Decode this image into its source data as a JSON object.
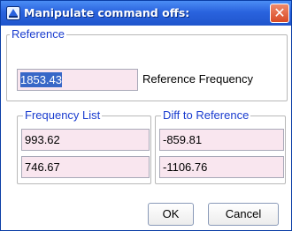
{
  "window": {
    "title": "Manipulate command offs:",
    "close_glyph": "✕",
    "colors": {
      "titlebar": "#2a63de",
      "accent_text": "#1a3ccf",
      "field_bg": "#f9e6ef",
      "selection": "#3867c7"
    }
  },
  "reference": {
    "group_label": "Reference",
    "value": "1853.43",
    "description": "Reference Frequency"
  },
  "frequency_list": {
    "group_label": "Frequency List",
    "values": [
      "993.62",
      "746.67"
    ]
  },
  "diff_to_reference": {
    "group_label": "Diff to Reference",
    "values": [
      "-859.81",
      "-1106.76"
    ]
  },
  "buttons": {
    "ok_label": "OK",
    "cancel_label": "Cancel"
  }
}
